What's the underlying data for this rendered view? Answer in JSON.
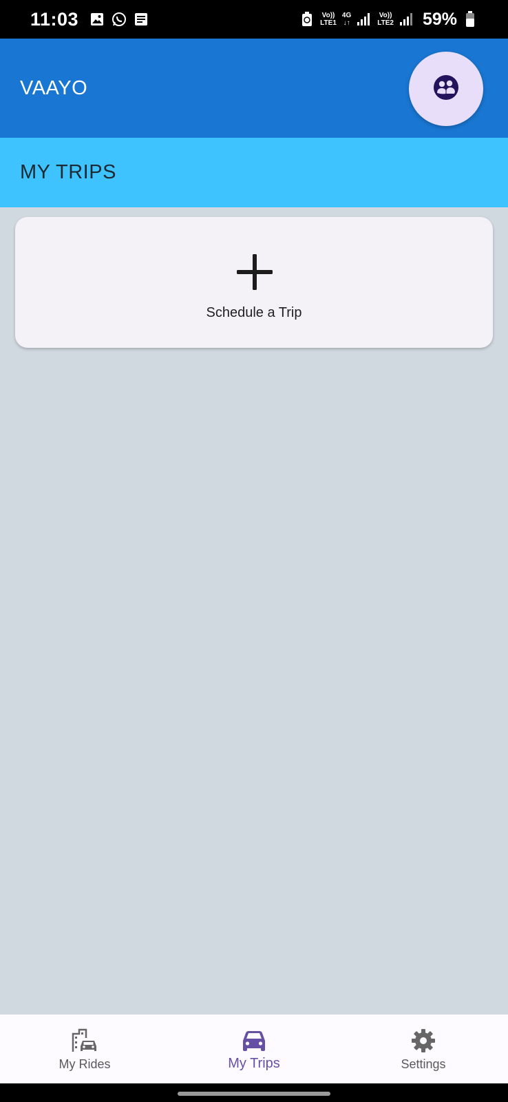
{
  "status_bar": {
    "time": "11:03",
    "sim1_top": "Vo))",
    "sim1_bottom": "LTE1",
    "net_type": "4G",
    "sim2_top": "Vo))",
    "sim2_bottom": "LTE2",
    "battery": "59%"
  },
  "app_bar": {
    "title": "VAAYO",
    "profile_icon": "people-icon",
    "profile_bg": "#e8defa",
    "background": "#1976d2"
  },
  "section": {
    "title": "MY TRIPS",
    "background": "#3ec3fe"
  },
  "schedule_card": {
    "icon": "plus-icon",
    "label": "Schedule a Trip"
  },
  "bottom_nav": {
    "items": [
      {
        "label": "My Rides",
        "icon": "building-car-icon",
        "active": false
      },
      {
        "label": "My Trips",
        "icon": "car-icon",
        "active": true
      },
      {
        "label": "Settings",
        "icon": "gear-icon",
        "active": false
      }
    ],
    "active_color": "#6550a4"
  },
  "content_background": "#d0d8e0"
}
